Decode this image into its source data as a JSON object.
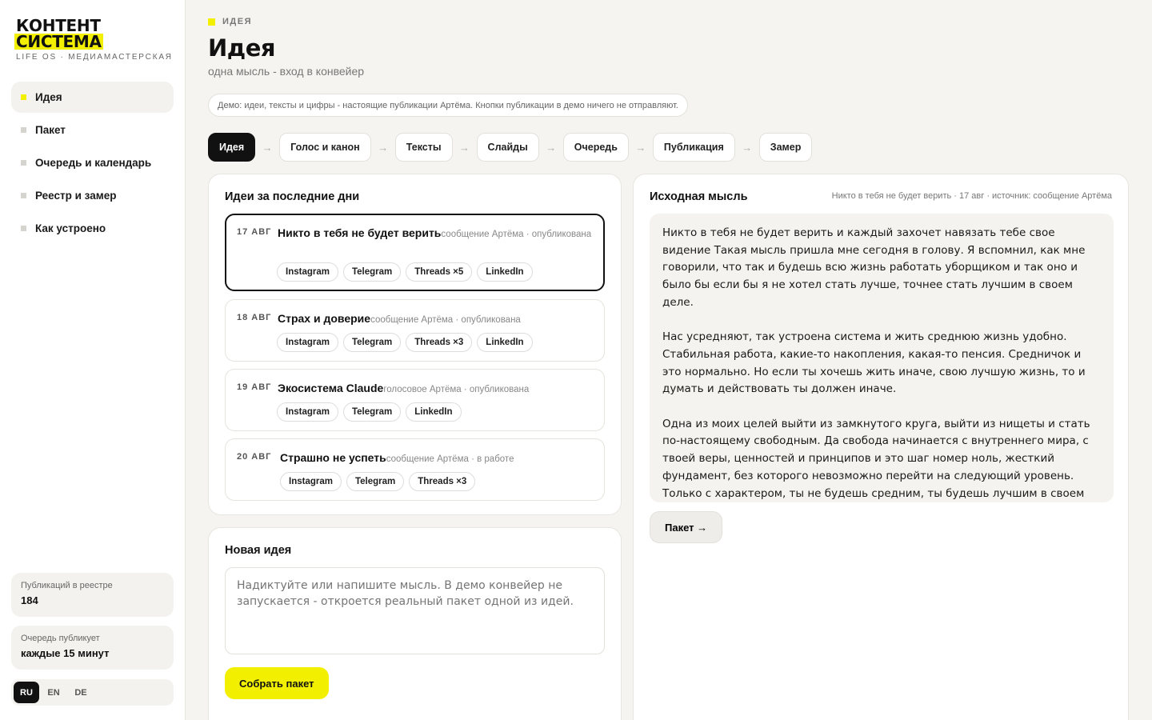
{
  "sidebar": {
    "logo": {
      "line1": "КОНТЕНТ",
      "line2": "СИСТЕМА",
      "subtitle": "LIFE OS · МЕДИАМАСТЕРСКАЯ"
    },
    "nav": [
      "Идея",
      "Пакет",
      "Очередь и календарь",
      "Реестр и замер",
      "Как устроено"
    ],
    "stats": [
      {
        "label": "Публикаций в реестре",
        "value": "184"
      },
      {
        "label": "Очередь публикует",
        "value": "каждые 15 минут"
      }
    ],
    "languages": [
      "RU",
      "EN",
      "DE"
    ]
  },
  "header": {
    "crumb": "ИДЕЯ",
    "title": "Идея",
    "subtitle": "одна мысль - вход в конвейер",
    "demo_note": "Демо: идеи, тексты и цифры - настоящие публикации Артёма. Кнопки публикации в демо ничего не отправляют."
  },
  "steps": [
    "Идея",
    "Голос и канон",
    "Тексты",
    "Слайды",
    "Очередь",
    "Публикация",
    "Замер"
  ],
  "ideas_card": {
    "title": "Идеи за последние дни",
    "items": [
      {
        "date": "17 АВГ",
        "title": "Никто в тебя не будет верить",
        "meta": "сообщение Артёма · опубликована",
        "chips": [
          "Instagram",
          "Telegram",
          "Threads ×5",
          "LinkedIn"
        ]
      },
      {
        "date": "18 АВГ",
        "title": "Страх и доверие",
        "meta": "сообщение Артёма · опубликована",
        "chips": [
          "Instagram",
          "Telegram",
          "Threads ×3",
          "LinkedIn"
        ]
      },
      {
        "date": "19 АВГ",
        "title": "Экосистема Claude",
        "meta": "голосовое Артёма · опубликована",
        "chips": [
          "Instagram",
          "Telegram",
          "LinkedIn"
        ]
      },
      {
        "date": "20 АВГ",
        "title": "Страшно не успеть",
        "meta": "сообщение Артёма · в работе",
        "chips": [
          "Instagram",
          "Telegram",
          "Threads ×3"
        ]
      }
    ]
  },
  "new_idea": {
    "title": "Новая идея",
    "placeholder": "Надиктуйте или напишите мысль. В демо конвейер не запускается - откроется реальный пакет одной из идей.",
    "button": "Собрать пакет"
  },
  "source": {
    "title": "Исходная мысль",
    "meta": "Никто в тебя не будет верить · 17 авг · источник: сообщение Артёма",
    "paragraphs": [
      "Никто в тебя не будет верить и каждый захочет навязать тебе свое видение Такая мысль пришла мне сегодня в голову. Я вспомнил, как мне говорили, что так и будешь всю жизнь работать уборщиком и так оно и было бы если бы я не хотел стать лучше, точнее стать лучшим в своем деле.",
      "Нас усредняют, так устроена система и жить среднюю жизнь удобно. Стабильная работа, какие-то накопления, какая-то пенсия. Средничок и это нормально. Но если ты хочешь жить иначе, свою лучшую жизнь, то и думать и действовать ты должен иначе.",
      "Одна из моих целей выйти из замкнутого круга, выйти из нищеты и стать по-настоящему свободным. Да свобода начинается с внутреннего мира, с твоей веры, ценностей и принципов и это шаг номер ноль, жесткий фундамент, без которого невозможно перейти на следующий уровень. Только с характером, ты не будешь средним, ты будешь лучшим в своем деле потому что просто не можешь иначе."
    ],
    "button": "Пакет →"
  }
}
